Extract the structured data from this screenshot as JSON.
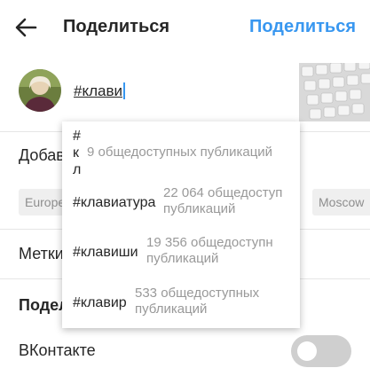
{
  "header": {
    "title": "Поделиться",
    "share_label": "Поделиться"
  },
  "caption": {
    "value": "#клави"
  },
  "rows": {
    "add_place": "Добав",
    "tag_people": "Метки",
    "share_section": "Подел",
    "vkontakte": "ВКонтакте"
  },
  "location_chips": [
    "Europe",
    "Moscow"
  ],
  "toggle": {
    "vkontakte_on": false
  },
  "suggestions": [
    {
      "tag_lines": [
        "#",
        "к",
        "л"
      ],
      "count": "9 общедоступных публикаций"
    },
    {
      "tag": "#клавиатура",
      "count_lines": [
        "22 064 общедоступ",
        "публикаций"
      ]
    },
    {
      "tag": "#клавиши",
      "count_lines": [
        "19 356 общедоступн",
        "публикаций"
      ]
    },
    {
      "tag": "#клавир",
      "count_lines": [
        "533 общедоступных",
        "публикаций"
      ]
    }
  ],
  "colors": {
    "accent": "#3897f0",
    "text": "#262626",
    "muted": "#999999",
    "toggle_off": "#cfcfcf"
  }
}
